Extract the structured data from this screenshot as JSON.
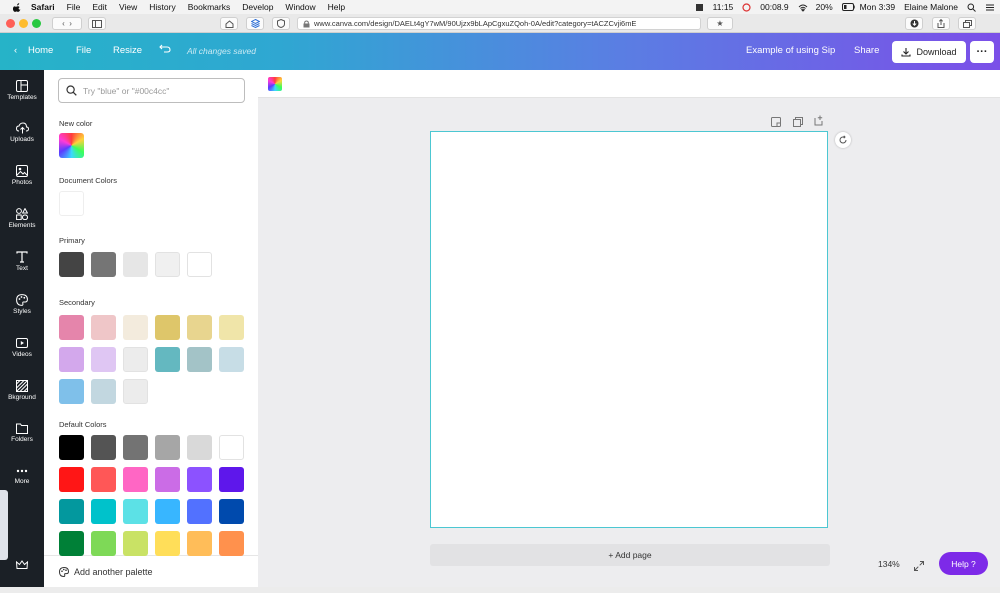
{
  "menubar": {
    "app": "Safari",
    "items": [
      "File",
      "Edit",
      "View",
      "History",
      "Bookmarks",
      "Develop",
      "Window",
      "Help"
    ],
    "clock1": "11:15",
    "timer": "00:08.9",
    "battery": "20%",
    "time": "Mon 3:39",
    "user": "Elaine Malone"
  },
  "browser": {
    "url": "www.canva.com/design/DAELt4gY7wM/90Ujzx9bLApCgxuZQoh-0A/edit?category=tACZCvji6mE"
  },
  "header": {
    "home": "Home",
    "file": "File",
    "resize": "Resize",
    "saved": "All changes saved",
    "title": "Example of using Sip",
    "share": "Share",
    "download": "Download"
  },
  "leftnav": [
    {
      "label": "Templates",
      "icon": "templates-icon"
    },
    {
      "label": "Uploads",
      "icon": "upload-icon"
    },
    {
      "label": "Photos",
      "icon": "photo-icon"
    },
    {
      "label": "Elements",
      "icon": "elements-icon"
    },
    {
      "label": "Text",
      "icon": "text-icon"
    },
    {
      "label": "Styles",
      "icon": "palette-icon"
    },
    {
      "label": "Videos",
      "icon": "video-icon"
    },
    {
      "label": "Bkground",
      "icon": "background-icon"
    },
    {
      "label": "Folders",
      "icon": "folder-icon"
    },
    {
      "label": "More",
      "icon": "more-icon"
    }
  ],
  "panel": {
    "search_placeholder": "Try \"blue\" or \"#00c4cc\"",
    "new_color": "New color",
    "document_colors": "Document Colors",
    "primary": "Primary",
    "secondary": "Secondary",
    "default_colors": "Default Colors",
    "add_palette": "Add another palette",
    "primary_swatches": [
      "#444444",
      "#757575",
      "#e6e6e6",
      "#f0f0f0",
      "#ffffff"
    ],
    "secondary_swatches": [
      "#e585ab",
      "#efc6c8",
      "#f3ebdd",
      "#dec66a",
      "#e8d58f",
      "#f0e5a9",
      "#d3a8ec",
      "#dfc6f3",
      "#ececec",
      "#64b8c0",
      "#a3c3c7",
      "#c7dde6",
      "#7fc0ea",
      "#c2d7e0",
      "#ececec"
    ],
    "default_swatches": [
      "#000000",
      "#545454",
      "#737373",
      "#a6a6a6",
      "#d9d9d9",
      "#ffffff",
      "#ff1616",
      "#ff5757",
      "#ff66c4",
      "#cb6ce6",
      "#8c52ff",
      "#5e17eb",
      "#03989e",
      "#00c2cb",
      "#5ce1e6",
      "#38b6ff",
      "#5271ff",
      "#004aad",
      "#008037",
      "#7ed957",
      "#c9e265",
      "#ffde59",
      "#ffbd59",
      "#ff914d"
    ]
  },
  "editor": {
    "add_page": "+ Add page",
    "zoom": "134%",
    "help": "Help ?"
  }
}
